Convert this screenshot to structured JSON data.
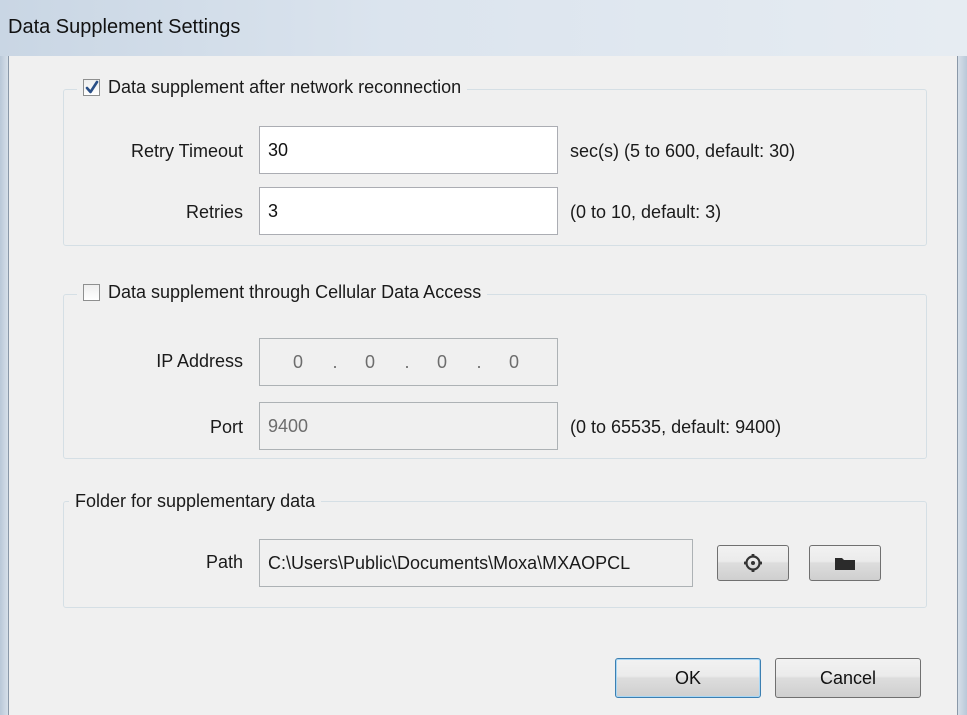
{
  "window": {
    "title": "Data Supplement Settings"
  },
  "reconnect_group": {
    "checkbox_label": "Data supplement after network reconnection",
    "checked": true,
    "retry_timeout": {
      "label": "Retry Timeout",
      "value": "30",
      "hint": "sec(s) (5 to 600, default: 30)"
    },
    "retries": {
      "label": "Retries",
      "value": "3",
      "hint": "(0 to 10, default: 3)"
    }
  },
  "cellular_group": {
    "checkbox_label": "Data supplement through Cellular Data Access",
    "checked": false,
    "ip_address": {
      "label": "IP Address",
      "octets": [
        "0",
        "0",
        "0",
        "0"
      ]
    },
    "port": {
      "label": "Port",
      "value": "9400",
      "hint": "(0 to 65535, default: 9400)"
    }
  },
  "folder_group": {
    "title": "Folder for supplementary data",
    "path": {
      "label": "Path",
      "value": "C:\\Users\\Public\\Documents\\Moxa\\MXAOPCL"
    },
    "reset_icon": "gear-icon",
    "browse_icon": "folder-icon"
  },
  "buttons": {
    "ok": "OK",
    "cancel": "Cancel"
  },
  "colors": {
    "accent": "#3c7fb1",
    "check": "#2a4f86",
    "titlebar": "#dbe4ee"
  }
}
